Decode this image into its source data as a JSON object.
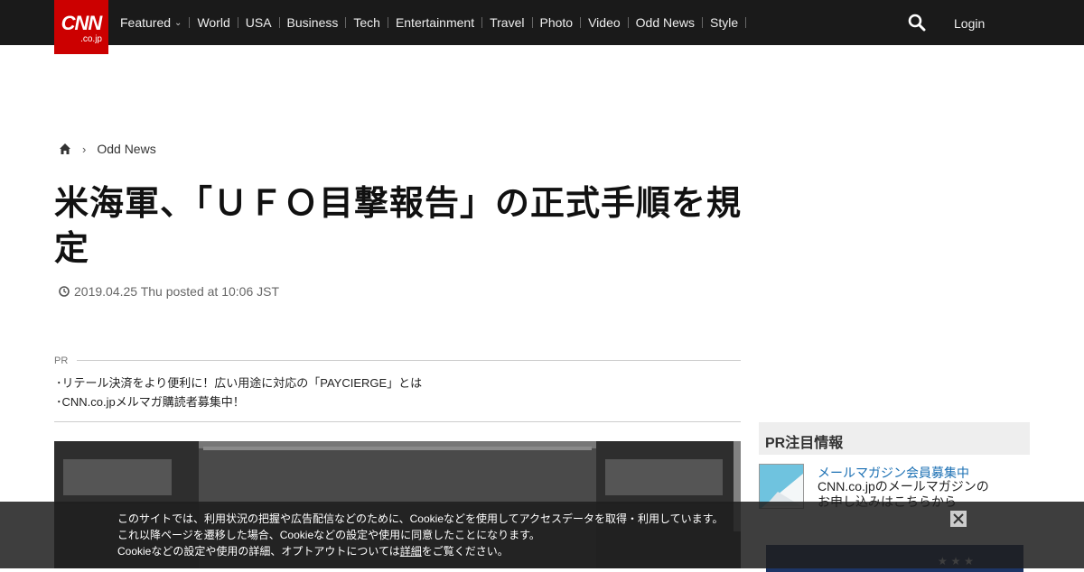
{
  "brand": {
    "line1": "CNN",
    "line2": ".co.jp"
  },
  "nav": {
    "items": [
      "Featured",
      "World",
      "USA",
      "Business",
      "Tech",
      "Entertainment",
      "Travel",
      "Photo",
      "Video",
      "Odd News",
      "Style"
    ],
    "login": "Login"
  },
  "breadcrumb": {
    "section": "Odd News"
  },
  "article": {
    "title": "米海軍、「ＵＦＯ目撃報告」の正式手順を規定",
    "date": "2019.04.25 Thu posted at 10:06 JST"
  },
  "pr": {
    "label": "PR",
    "links": [
      "･リテール決済をより便利に！広い用途に対応の「PAYCIERGE」とは",
      "･CNN.co.jpメルマガ購読者募集中！"
    ]
  },
  "sidebar": {
    "heading": "PR注目情報",
    "item_link": "メールマガジン会員募集中",
    "item_desc": "CNN.co.jpのメールマガジンのお申し込みはこちらから"
  },
  "cookie": {
    "line1": "このサイトでは、利用状況の把握や広告配信などのために、Cookieなどを使用してアクセスデータを取得・利用しています。",
    "line2": "これ以降ページを遷移した場合、Cookieなどの設定や使用に同意したことになります。",
    "line3_pre": "Cookieなどの設定や使用の詳細、オプトアウトについては",
    "line3_link": "詳細",
    "line3_post": "をご覧ください。"
  },
  "colors": {
    "brand_red": "#cc0000",
    "topbar": "#1a1a1a",
    "link_blue": "#1a6fb3"
  }
}
